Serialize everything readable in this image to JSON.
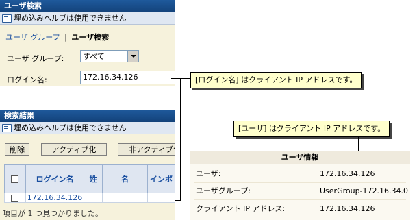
{
  "user_search": {
    "title": "ユーザ検索",
    "help_text": "埋め込みヘルプは使用できません",
    "tabs": {
      "group": "ユーザ グループ",
      "separator": "|",
      "search": "ユーザ検索"
    },
    "group_label": "ユーザ グループ:",
    "group_value": "すべて",
    "login_label": "ログイン名:",
    "login_value": "172.16.34.126"
  },
  "callouts": {
    "login": "[ログイン名] はクライアント IP アドレスです。",
    "user": "[ユーザ] はクライアント IP アドレスです。"
  },
  "search_results": {
    "title": "検索結果",
    "help_text": "埋め込みヘルプは使用できません",
    "buttons": {
      "delete": "削除",
      "activate": "アクティブ化",
      "deactivate": "非アクティブ化"
    },
    "columns": {
      "login": "ログイン名",
      "last": "姓",
      "first": "名",
      "import": "インポ"
    },
    "row": {
      "login": "172.16.34.126"
    },
    "footer": "項目が 1 つ見つかりました。"
  },
  "user_info": {
    "title": "ユーザ情報",
    "rows": [
      {
        "label": "ユーザ:",
        "value": "172.16.34.126"
      },
      {
        "label": "ユーザグループ:",
        "value": "UserGroup-172.16.34.0"
      },
      {
        "label": "クライアント IP アドレス:",
        "value": "172.16.34.126"
      }
    ]
  }
}
